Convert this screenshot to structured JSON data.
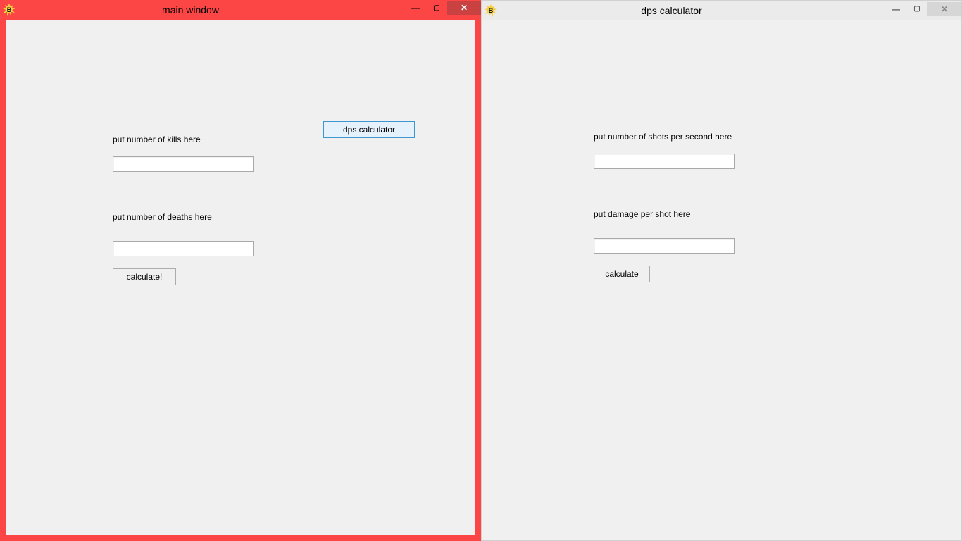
{
  "left_window": {
    "title": "main window",
    "kills_label": "put number of kills here",
    "kills_value": "",
    "deaths_label": "put number of deaths here",
    "deaths_value": "",
    "calculate_label": "calculate!",
    "dps_button_label": "dps calculator"
  },
  "right_window": {
    "title": "dps calculator",
    "shots_label": "put number of shots per second here",
    "shots_value": "",
    "damage_label": "put damage per shot here",
    "damage_value": "",
    "calculate_label": "calculate"
  },
  "glyphs": {
    "minimize": "—",
    "maximize": "▢",
    "close": "✕"
  }
}
